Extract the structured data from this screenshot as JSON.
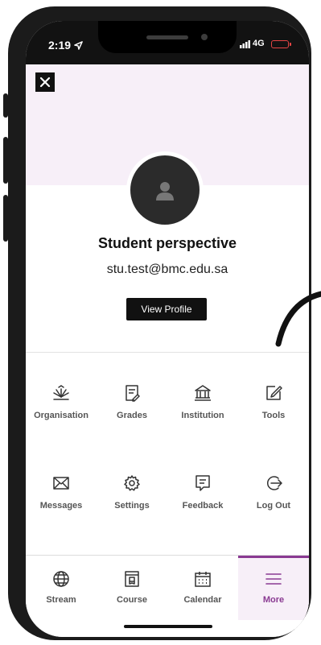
{
  "status_bar": {
    "time": "2:19",
    "network": "4G"
  },
  "profile": {
    "name": "Student perspective",
    "email": "stu.test@bmc.edu.sa",
    "view_profile_label": "View Profile"
  },
  "menu": {
    "items": [
      {
        "label": "Organisation",
        "icon": "organisation-icon"
      },
      {
        "label": "Grades",
        "icon": "grades-icon"
      },
      {
        "label": "Institution",
        "icon": "institution-icon"
      },
      {
        "label": "Tools",
        "icon": "tools-icon"
      },
      {
        "label": "Messages",
        "icon": "envelope-icon"
      },
      {
        "label": "Settings",
        "icon": "gear-icon"
      },
      {
        "label": "Feedback",
        "icon": "feedback-icon"
      },
      {
        "label": "Log Out",
        "icon": "logout-icon"
      }
    ]
  },
  "tab_bar": {
    "tabs": [
      {
        "label": "Stream",
        "icon": "globe-icon"
      },
      {
        "label": "Course",
        "icon": "course-icon"
      },
      {
        "label": "Calendar",
        "icon": "calendar-icon"
      },
      {
        "label": "More",
        "icon": "menu-icon",
        "active": true
      }
    ]
  },
  "colors": {
    "accent": "#8a3a92",
    "header_background": "#f7eff8",
    "battery_low": "#e54545"
  }
}
